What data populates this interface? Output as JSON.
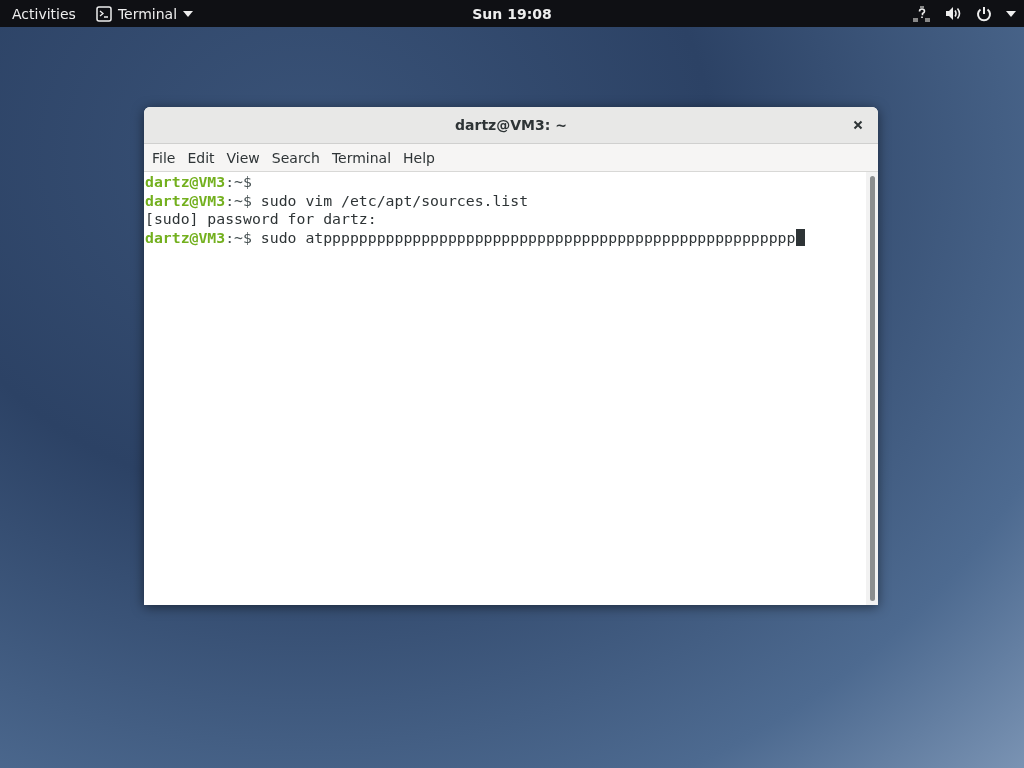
{
  "top_bar": {
    "activities": "Activities",
    "app_menu": "Terminal",
    "clock": "Sun 19:08"
  },
  "window": {
    "title": "dartz@VM3: ~",
    "menu": [
      "File",
      "Edit",
      "View",
      "Search",
      "Terminal",
      "Help"
    ]
  },
  "terminal": {
    "lines": [
      {
        "kind": "prompt",
        "user": "dartz@VM3",
        "path": ":~$"
      },
      {
        "kind": "prompt",
        "user": "dartz@VM3",
        "path": ":~$",
        "command": "sudo vim /etc/apt/sources.list"
      },
      {
        "kind": "output",
        "text": "[sudo] password for dartz:"
      },
      {
        "kind": "prompt",
        "user": "dartz@VM3",
        "path": ":~$",
        "command": "sudo atppppppppppppppppppppppppppppppppppppppppppppppppppppp",
        "cursor": true
      }
    ]
  }
}
